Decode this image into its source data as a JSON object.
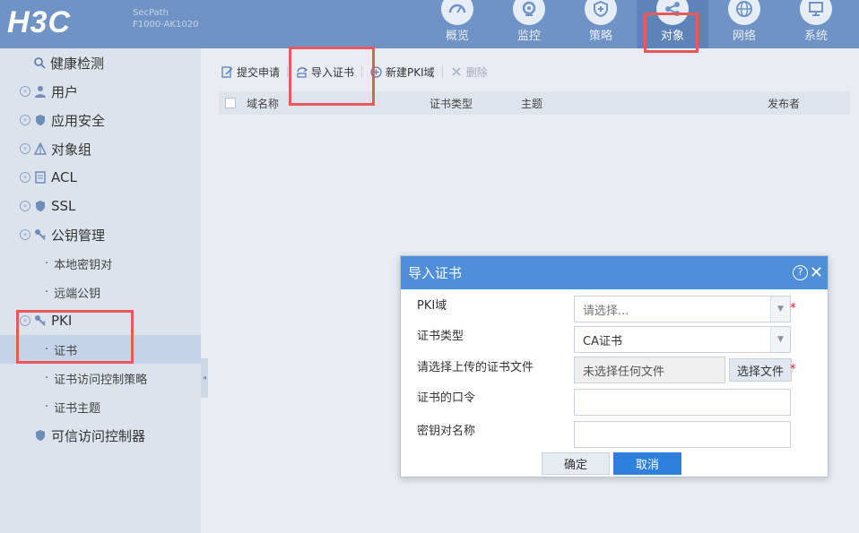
{
  "header": {
    "logo": "H3C",
    "device_line1": "SecPath",
    "device_line2": "F1000-AK1020",
    "nav": [
      {
        "label": "概览",
        "icon": "dashboard-icon"
      },
      {
        "label": "监控",
        "icon": "webcam-icon"
      },
      {
        "label": "策略",
        "icon": "shield-icon"
      },
      {
        "label": "对象",
        "icon": "share-icon",
        "active": true
      },
      {
        "label": "网络",
        "icon": "globe-icon"
      },
      {
        "label": "系统",
        "icon": "monitor-icon"
      }
    ]
  },
  "sidebar": {
    "items": [
      {
        "label": "健康检测"
      },
      {
        "label": "用户"
      },
      {
        "label": "应用安全"
      },
      {
        "label": "对象组"
      },
      {
        "label": "ACL"
      },
      {
        "label": "SSL"
      },
      {
        "label": "公钥管理"
      },
      {
        "label": "本地密钥对"
      },
      {
        "label": "远端公钥"
      },
      {
        "label": "PKI"
      },
      {
        "label": "证书"
      },
      {
        "label": "证书访问控制策略"
      },
      {
        "label": "证书主题"
      },
      {
        "label": "可信访问控制器"
      }
    ]
  },
  "toolbar": {
    "submit_request": "提交申请",
    "import_cert": "导入证书",
    "new_pki_domain": "新建PKI域",
    "delete": "删除"
  },
  "table": {
    "columns": [
      "域名称",
      "证书类型",
      "主题",
      "发布者"
    ]
  },
  "dialog": {
    "title": "导入证书",
    "pki_domain_label": "PKI域",
    "pki_domain_placeholder": "请选择...",
    "cert_type_label": "证书类型",
    "cert_type_value": "CA证书",
    "file_label": "请选择上传的证书文件",
    "file_status": "未选择任何文件",
    "file_button": "选择文件",
    "password_label": "证书的口令",
    "keypair_label": "密钥对名称",
    "ok": "确定",
    "cancel": "取消",
    "required_mark": "*"
  },
  "colors": {
    "accent": "#4f8fd9",
    "topbar": "#6f93c4",
    "highlight": "#e85a5a"
  }
}
